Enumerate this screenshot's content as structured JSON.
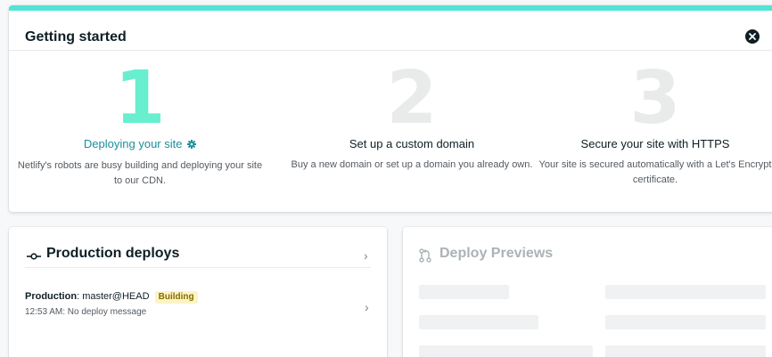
{
  "getting_started": {
    "title": "Getting started",
    "close_icon": "close-circle-icon",
    "steps": [
      {
        "number": "1",
        "title": "Deploying your site",
        "description": "Netlify's robots are busy building and deploying your site to our CDN.",
        "status": "active",
        "icon": "gear-icon",
        "color": "#67efcf"
      },
      {
        "number": "2",
        "title": "Set up a custom domain",
        "description": "Buy a new domain or set up a domain you already own.",
        "status": "pending",
        "color": "#e9ebeb"
      },
      {
        "number": "3",
        "title": "Secure your site with HTTPS",
        "description": "Your site is secured automatically with a Let's Encrypt certificate.",
        "status": "pending",
        "color": "#e9ebeb"
      }
    ]
  },
  "production_deploys": {
    "title": "Production deploys",
    "icon": "commit-icon",
    "deploy": {
      "label": "Production",
      "separator": ":",
      "branch": "master@HEAD",
      "badge": "Building",
      "time_message": "12:53 AM: No deploy message"
    }
  },
  "deploy_previews": {
    "title": "Deploy Previews",
    "icon": "pull-request-icon"
  },
  "colors": {
    "accent": "#52e5d6",
    "active_step_title": "#1b8f9b",
    "badge_bg": "#fbf4c5"
  }
}
